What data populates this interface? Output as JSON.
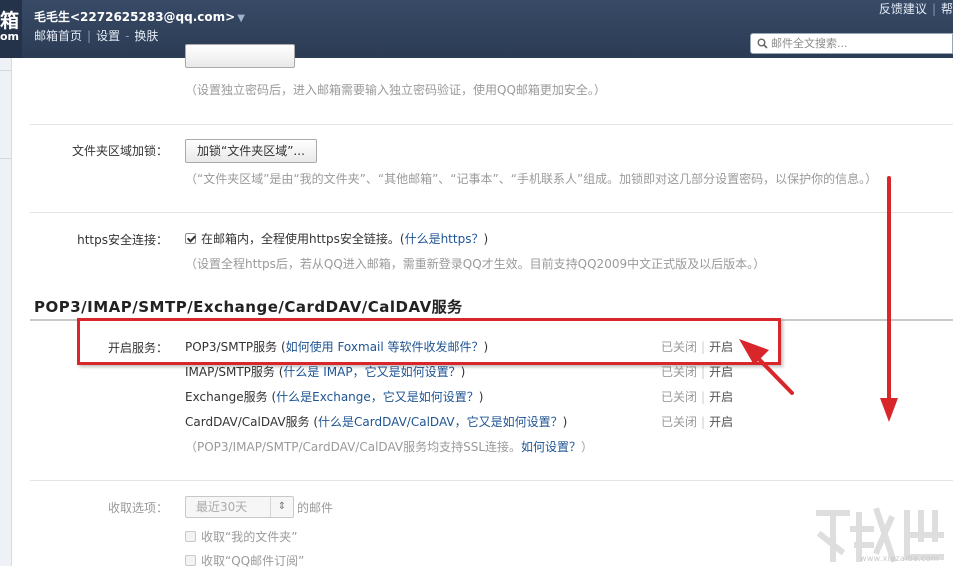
{
  "header": {
    "logo_char": "箱",
    "logo_sub": "om",
    "user": "毛毛生<2272625283@qq.com>",
    "nav": [
      "邮箱首页",
      "设置",
      "换肤"
    ],
    "top_links": [
      "反馈建议",
      "帮"
    ],
    "search_placeholder": "邮件全文搜索..."
  },
  "security": {
    "password_note": "（设置独立密码后，进入邮箱需要输入独立密码验证，使用QQ邮箱更加安全。）",
    "folder_lock_label": "文件夹区域加锁：",
    "folder_lock_button": "加锁“文件夹区域”...",
    "folder_lock_note": "（“文件夹区域”是由“我的文件夹”、“其他邮箱”、“记事本”、“手机联系人”组成。加锁即对这几部分设置密码，以保护你的信息。）",
    "https_label": "https安全连接：",
    "https_check_text": "在邮箱内，全程使用https安全链接。(",
    "https_help_link": "什么是https？",
    "https_close": ")",
    "https_note": "（设置全程https后，若从QQ进入邮箱，需重新登录QQ才生效。目前支持QQ2009中文正式版及以后版本。）"
  },
  "services": {
    "section_title": "POP3/IMAP/SMTP/Exchange/CardDAV/CalDAV服务",
    "open_label": "开启服务：",
    "rows": [
      {
        "name": "POP3/SMTP服务",
        "open": " (",
        "help": "如何使用 Foxmail 等软件收发邮件？",
        "close": ")",
        "status_off": "已关闭",
        "status_on": "开启"
      },
      {
        "name": "IMAP/SMTP服务",
        "open": " (",
        "help": "什么是 IMAP，它又是如何设置？",
        "close": ")",
        "status_off": "已关闭",
        "status_on": "开启"
      },
      {
        "name": "Exchange服务",
        "open": " (",
        "help": "什么是Exchange，它又是如何设置？",
        "close": ")",
        "status_off": "已关闭",
        "status_on": "开启"
      },
      {
        "name": "CardDAV/CalDAV服务",
        "open": " (",
        "help": "什么是CardDAV/CalDAV，它又是如何设置？",
        "close": ")",
        "status_off": "已关闭",
        "status_on": "开启"
      }
    ],
    "ssl_note": "（POP3/IMAP/SMTP/CardDAV/CalDAV服务均支持SSL连接。",
    "ssl_link": "如何设置？",
    "ssl_close": "）"
  },
  "receive": {
    "label": "收取选项：",
    "range_value": "最近30天",
    "range_suffix": "的邮件",
    "opt_my_folders": "收取“我的文件夹”",
    "opt_qq_subscriptions": "收取“QQ邮件订阅”"
  },
  "watermark": {
    "sub": "www.xiazaiba.com"
  },
  "colors": {
    "accent_link": "#1e5494",
    "annotation": "#d8262a",
    "header_bg": "#2f4058"
  }
}
